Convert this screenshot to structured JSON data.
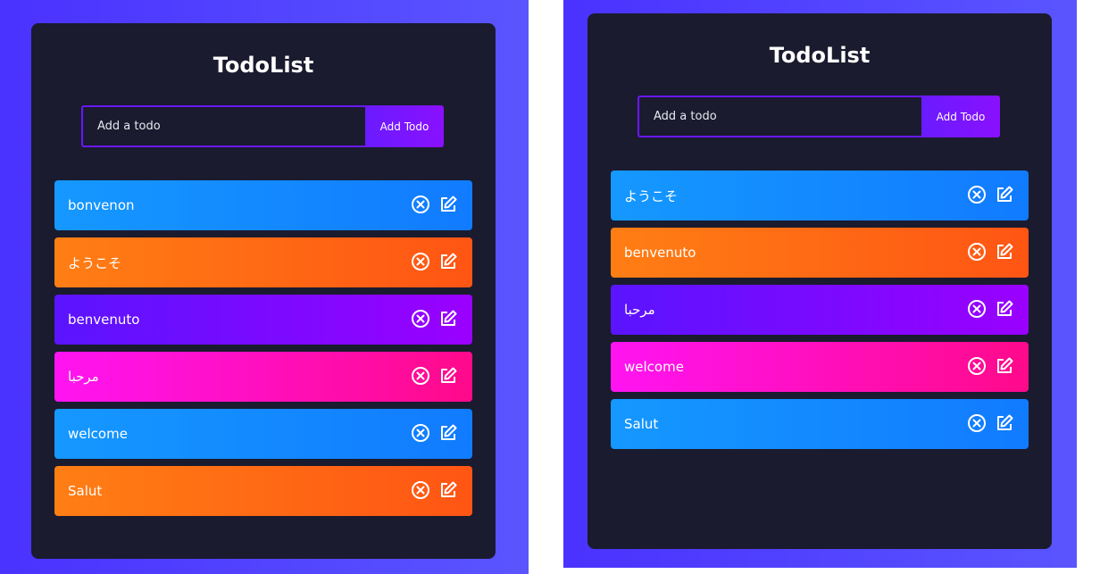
{
  "left": {
    "title": "TodoList",
    "input_placeholder": "Add a todo",
    "add_label": "Add Todo",
    "todos": [
      {
        "text": "bonvenon",
        "color": "#1598ff"
      },
      {
        "text": "ようこそ",
        "color": "#ff7e14"
      },
      {
        "text": "benvenuto",
        "color": "#5a14ff"
      },
      {
        "text": "مرحبا",
        "color": "#ff14f2"
      },
      {
        "text": "welcome",
        "color": "#1598ff"
      },
      {
        "text": "Salut",
        "color": "#ff7e14"
      }
    ]
  },
  "right": {
    "title": "TodoList",
    "input_placeholder": "Add a todo",
    "add_label": "Add Todo",
    "todos": [
      {
        "text": "ようこそ",
        "color": "#1598ff"
      },
      {
        "text": "benvenuto",
        "color": "#ff7e14"
      },
      {
        "text": "مرحبا",
        "color": "#5a14ff"
      },
      {
        "text": "welcome",
        "color": "#ff14f2"
      },
      {
        "text": "Salut",
        "color": "#1598ff"
      }
    ]
  },
  "icons": {
    "delete": "close-circle-icon",
    "edit": "edit-icon"
  }
}
